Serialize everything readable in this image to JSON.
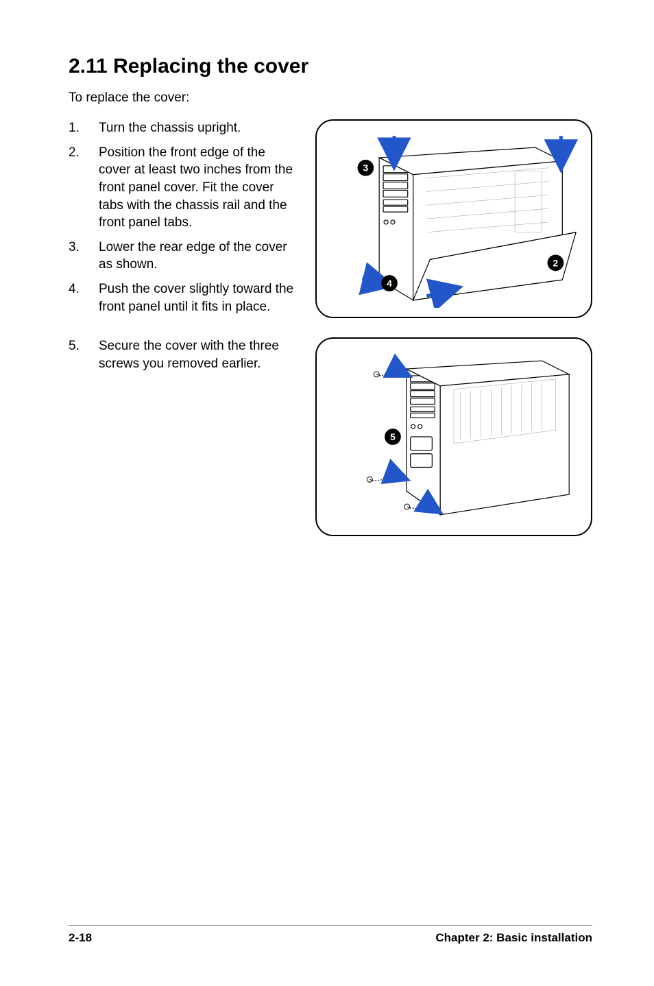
{
  "heading": "2.11   Replacing the cover",
  "intro": "To replace the cover:",
  "steps1": [
    {
      "num": "1.",
      "text": "Turn the chassis upright."
    },
    {
      "num": "2.",
      "text": "Position the front edge of the cover at least two inches from the front panel cover. Fit the cover tabs with the chassis rail and the front panel tabs."
    },
    {
      "num": "3.",
      "text": "Lower the rear edge of the cover as shown."
    },
    {
      "num": "4.",
      "text": "Push the cover slightly toward the front panel until it fits in place."
    }
  ],
  "steps2": [
    {
      "num": "5.",
      "text": "Secure the cover with the three screws you removed earlier."
    }
  ],
  "badges1": {
    "a": "3",
    "b": "2",
    "c": "4"
  },
  "badges2": {
    "a": "5"
  },
  "footer": {
    "left": "2-18",
    "right": "Chapter 2: Basic installation"
  }
}
